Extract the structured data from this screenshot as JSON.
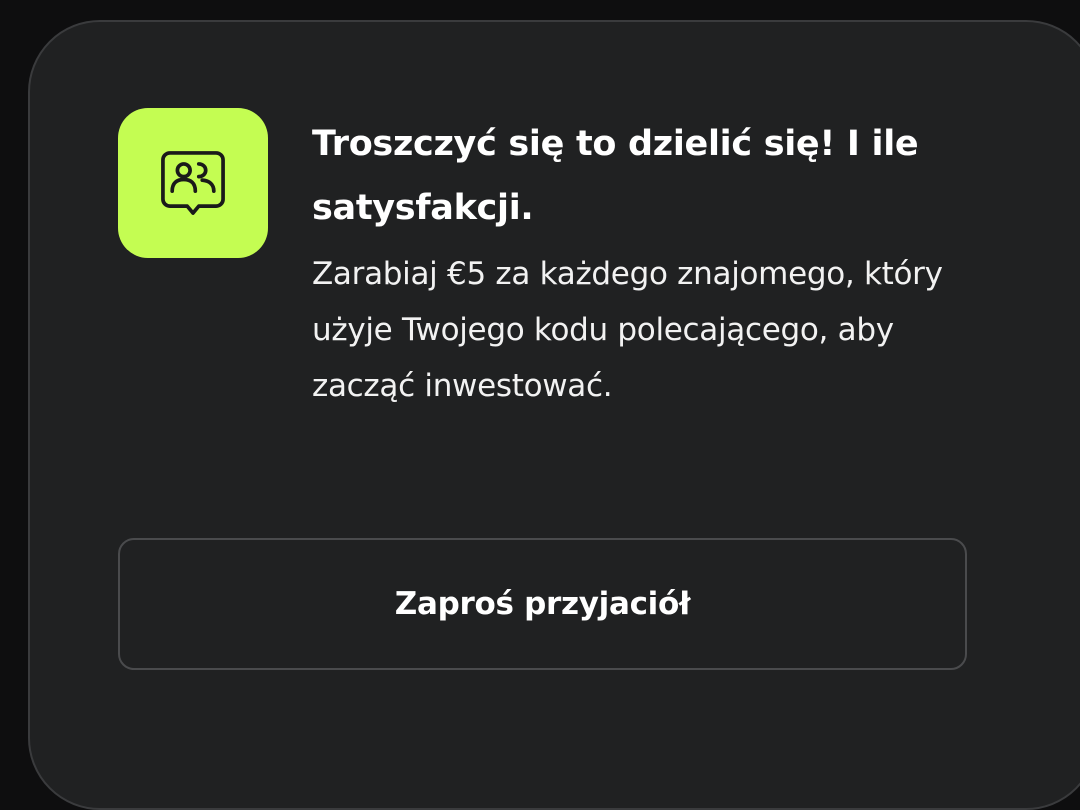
{
  "card": {
    "icon": "people-chat-bubble-icon",
    "title": "Troszczyć się to dzielić się! I ile satysfakcji.",
    "description": "Zarabiaj €5 za każdego znajomego, który użyje Twojego kodu polecającego, aby zacząć inwestować.",
    "button_label": "Zaproś przyjaciół"
  },
  "colors": {
    "background": "#0e0e0f",
    "card": "#202122",
    "accent": "#c4fd52",
    "text": "#ffffff"
  }
}
